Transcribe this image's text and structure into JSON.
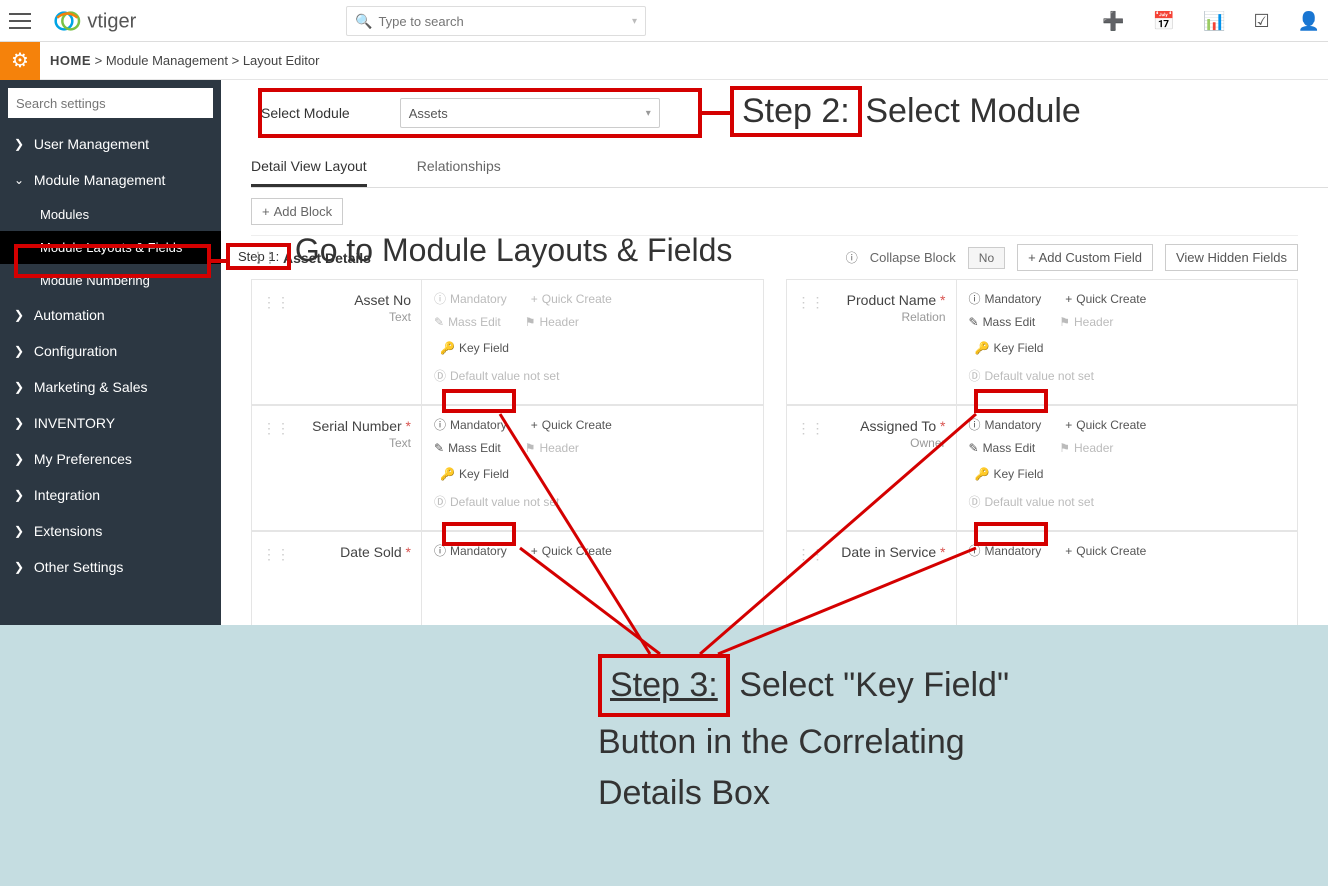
{
  "topbar": {
    "search_placeholder": "Type to search"
  },
  "breadcrumb": {
    "home": "HOME",
    "module_mgmt": "Module Management",
    "layout_editor": "Layout Editor"
  },
  "sidebar": {
    "search_placeholder": "Search settings",
    "items": [
      "User Management",
      "Module Management",
      "Automation",
      "Configuration",
      "Marketing & Sales",
      "INVENTORY",
      "My Preferences",
      "Integration",
      "Extensions",
      "Other Settings"
    ],
    "subs": [
      "Modules",
      "Module Layouts & Fields",
      "Module Numbering"
    ]
  },
  "main": {
    "select_module_label": "Select Module",
    "select_module_value": "Assets",
    "tabs": {
      "detail": "Detail View Layout",
      "rel": "Relationships"
    },
    "add_block": "Add Block",
    "block_title": "Asset Details",
    "collapse_label": "Collapse Block",
    "no": "No",
    "add_custom_field": "Add Custom Field",
    "view_hidden": "View Hidden Fields",
    "labels": {
      "mandatory": "Mandatory",
      "quick_create": "Quick Create",
      "mass_edit": "Mass Edit",
      "header": "Header",
      "key_field": "Key Field",
      "default_not_set": "Default value not set"
    },
    "fields": [
      {
        "name": "Asset No",
        "type": "Text",
        "required": false
      },
      {
        "name": "Product Name",
        "type": "Relation",
        "required": true
      },
      {
        "name": "Serial Number",
        "type": "Text",
        "required": true
      },
      {
        "name": "Assigned To",
        "type": "Owner",
        "required": true
      },
      {
        "name": "Date Sold",
        "type": "",
        "required": true
      },
      {
        "name": "Date in Service",
        "type": "",
        "required": true
      }
    ]
  },
  "annotations": {
    "step1_label": "Step 1:",
    "step1_text": "Go to Module Layouts & Fields",
    "step2_label": "Step 2:",
    "step2_text": "Select Module",
    "step3_label": "Step 3:",
    "step3_text": "Select \"Key Field\" Button in the Correlating Details Box"
  }
}
